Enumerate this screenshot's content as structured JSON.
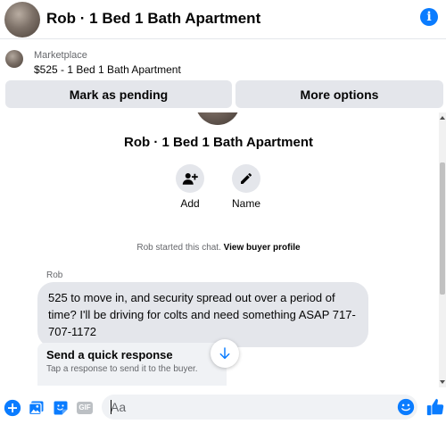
{
  "header": {
    "title": "Rob · 1 Bed 1 Bath Apartment"
  },
  "marketplace": {
    "label": "Marketplace",
    "item": "$525 - 1 Bed 1 Bath Apartment"
  },
  "actions": {
    "pending_label": "Mark as pending",
    "more_label": "More options"
  },
  "profile": {
    "name": "Rob · 1 Bed 1 Bath Apartment",
    "add_label": "Add",
    "name_label": "Name"
  },
  "chat": {
    "started_text": "Rob started this chat.",
    "view_profile_link": "View buyer profile",
    "sender": "Rob",
    "message": "525 to move in, and security spread out over a period of time? I'll be driving for colts and need something ASAP 717-707-1172"
  },
  "quick_response": {
    "title": "Send a quick response",
    "subtitle": "Tap a response to send it to the buyer."
  },
  "composer": {
    "placeholder": "Aa"
  },
  "icons": {
    "info": "info-icon",
    "add_person": "add-person-icon",
    "edit": "pencil-icon",
    "scroll_down": "arrow-down-icon",
    "plus": "plus-circle-icon",
    "photo": "photo-icon",
    "sticker": "sticker-icon",
    "gif": "gif-icon",
    "emoji": "emoji-icon",
    "like": "thumbs-up-icon"
  },
  "colors": {
    "accent": "#0a7cff",
    "button_bg": "#e4e6eb",
    "bubble_bg": "#e4e6eb",
    "secondary_text": "#65676b"
  }
}
